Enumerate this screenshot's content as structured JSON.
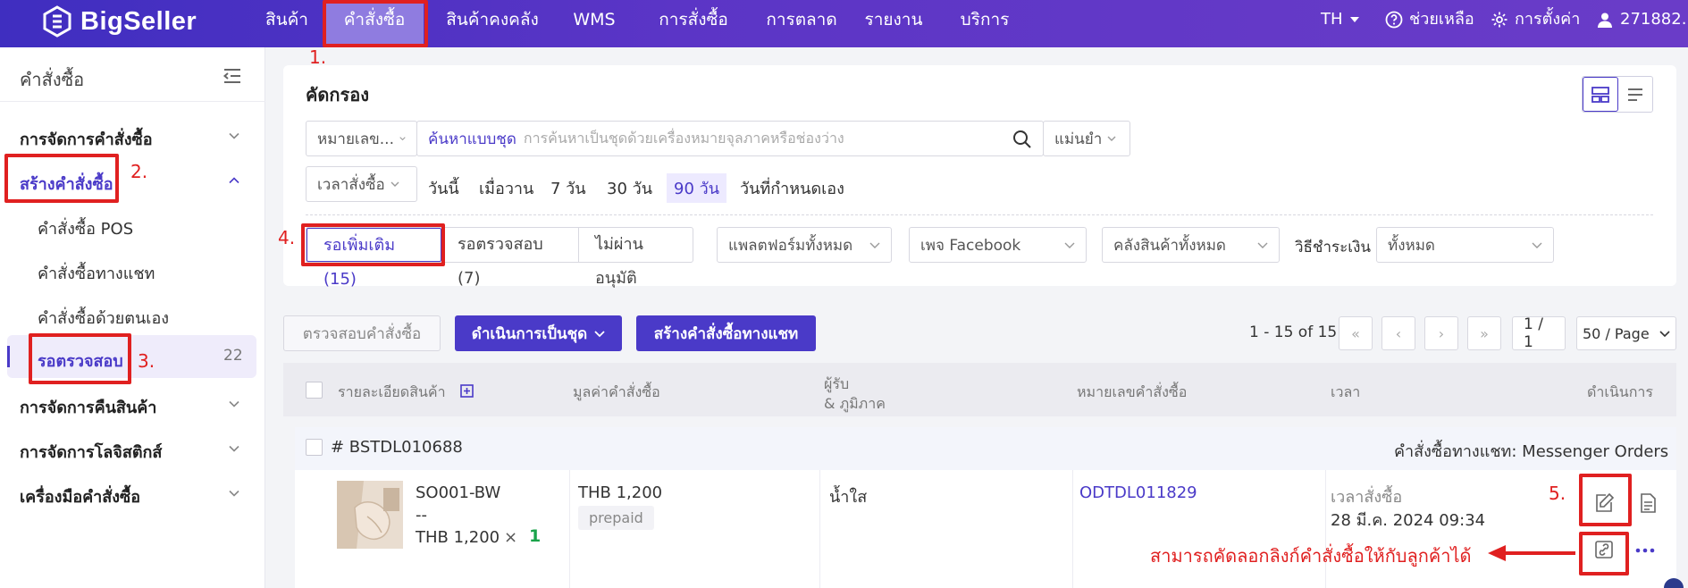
{
  "brand": {
    "name": "BigSeller"
  },
  "nav": {
    "items": [
      "สินค้า",
      "คำสั่งซื้อ",
      "สินค้าคงคลัง",
      "WMS",
      "การสั่งซื้อ",
      "การตลาด",
      "รายงาน",
      "บริการ"
    ],
    "active": "คำสั่งซื้อ"
  },
  "topright": {
    "lang": "TH",
    "help": "ช่วยเหลือ",
    "settings": "การตั้งค่า",
    "user": "271882..."
  },
  "sidebar": {
    "title": "คำสั่งซื้อ",
    "groups": [
      {
        "label": "การจัดการคำสั่งซื้อ"
      },
      {
        "label": "สร้างคำสั่งซื้อ",
        "expanded": true,
        "children": [
          "คำสั่งซื้อ POS",
          "คำสั่งซื้อทางแชท",
          "คำสั่งซื้อด้วยตนเอง",
          "รอตรวจสอบ"
        ]
      },
      {
        "label": "การจัดการคืนสินค้า"
      },
      {
        "label": "การจัดการโลจิสติกส์"
      },
      {
        "label": "เครื่องมือคำสั่งซื้อ"
      }
    ],
    "active_child": "รอตรวจสอบ",
    "active_count": "22"
  },
  "filter": {
    "title": "คัดกรอง",
    "search_field": "หมายเลข...",
    "batch_search_label": "ค้นหาแบบชุด",
    "search_placeholder": "การค้นหาเป็นชุดด้วยเครื่องหมายจุลภาคหรือช่องว่าง",
    "match_mode": "แม่นยำ",
    "time_field": "เวลาสั่งซื้อ",
    "time_options": [
      "วันนี้",
      "เมื่อวาน",
      "7 วัน",
      "30 วัน",
      "90 วัน",
      "วันที่กำหนดเอง"
    ],
    "time_selected": "90 วัน",
    "status_tabs": [
      "รอเพิ่มเติม (15)",
      "รอตรวจสอบ (7)",
      "ไม่ผ่านอนุมัติ"
    ],
    "status_active": "รอเพิ่มเติม (15)",
    "platform": "แพลตฟอร์มทั้งหมด",
    "page": "เพจ Facebook",
    "warehouse": "คลังสินค้าทั้งหมด",
    "payment_label": "วิธีชำระเงิน",
    "payment_value": "ทั้งหมด"
  },
  "actions": {
    "review": "ตรวจสอบคำสั่งซื้อ",
    "batch": "ดำเนินการเป็นชุด",
    "create_chat": "สร้างคำสั่งซื้อทางแชท"
  },
  "pagination": {
    "range": "1 - 15 of 15",
    "page": "1 / 1",
    "per_page": "50 / Page"
  },
  "table": {
    "headers": {
      "product": "รายละเอียดสินค้า",
      "value": "มูลค่าคำสั่งซื้อ",
      "recipient_1": "ผู้รับ",
      "recipient_2": "& ภูมิภาค",
      "order_no": "หมายเลขคำสั่งซื้อ",
      "time": "เวลา",
      "action": "ดำเนินการ"
    }
  },
  "order": {
    "id": "# BSTDL010688",
    "source": "คำสั่งซื้อทางแชท: Messenger Orders",
    "sku": "SO001-BW",
    "variant": "--",
    "price": "THB 1,200",
    "times": "×",
    "qty": "1",
    "total": "THB 1,200",
    "payment": "prepaid",
    "recipient": "น้ำใส",
    "order_no": "ODTDL011829",
    "time_label": "เวลาสั่งซื้อ",
    "time_value": "28 มี.ค. 2024 09:34"
  },
  "annotations": {
    "n1": "1.",
    "n2": "2.",
    "n3": "3.",
    "n4": "4.",
    "n5": "5.",
    "copy_link_note": "สามารถคัดลอกลิงก์คำสั่งซื้อให้กับลูกค้าได้"
  },
  "colors": {
    "brand": "#4a3ac8",
    "nav_bg": "#5b35c6",
    "annotation": "#e02020",
    "qty": "#1aa34a"
  }
}
